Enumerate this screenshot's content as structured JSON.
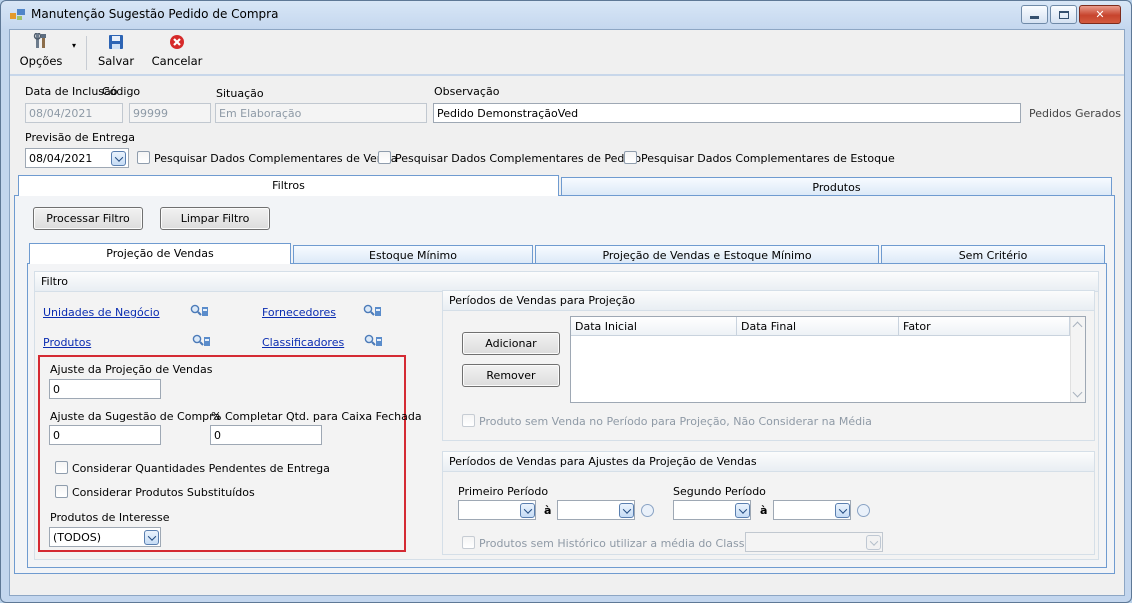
{
  "window": {
    "title": "Manutenção Sugestão Pedido de Compra",
    "controls": [
      "minimize-icon",
      "maximize-icon",
      "close-icon"
    ]
  },
  "toolbar": {
    "options_label": "Opções",
    "save_label": "Salvar",
    "cancel_label": "Cancelar",
    "icons": {
      "options": "tools-icon",
      "save": "floppy-disk-icon",
      "cancel": "cancel-x-icon"
    }
  },
  "header": {
    "data_inclusao_label": "Data de Inclusão",
    "data_inclusao_value": "08/04/2021",
    "codigo_label": "Código",
    "codigo_value": "99999",
    "situacao_label": "Situação",
    "situacao_value": "Em Elaboração",
    "observacao_label": "Observação",
    "observacao_value": "Pedido DemonstraçãoVed",
    "pedidos_gerados": "Pedidos Gerados",
    "previsao_label": "Previsão de Entrega",
    "previsao_value": "08/04/2021",
    "chk_venda": "Pesquisar Dados Complementares de Venda",
    "chk_pedido": "Pesquisar Dados Complementares de Pedido",
    "chk_estoque": "Pesquisar Dados Complementares de Estoque"
  },
  "main_tabs": {
    "filtros": "Filtros",
    "produtos": "Produtos"
  },
  "filter_buttons": {
    "processar": "Processar Filtro",
    "limpar": "Limpar Filtro"
  },
  "sub_tabs": {
    "projecao": "Projeção de Vendas",
    "estoque": "Estoque Mínimo",
    "proj_estoque": "Projeção de Vendas e Estoque Mínimo",
    "sem": "Sem Critério"
  },
  "filtro": {
    "title": "Filtro",
    "unidades": "Unidades de Negócio",
    "fornecedores": "Fornecedores",
    "produtos": "Produtos",
    "classificadores": "Classificadores",
    "ajuste_projecao_label": "Ajuste da Projeção de Vendas",
    "ajuste_projecao_value": "0",
    "ajuste_sugestao_label": "Ajuste da Sugestão de Compra",
    "ajuste_sugestao_value": "0",
    "completar_label": "% Completar Qtd. para Caixa Fechada",
    "completar_value": "0",
    "chk_pendentes": "Considerar Quantidades Pendentes de Entrega",
    "chk_substituidos": "Considerar Produtos Substituídos",
    "interesse_label": "Produtos de Interesse",
    "interesse_value": "(TODOS)",
    "colors": {
      "highlight_border": "#d42a33",
      "link": "#0b2db1"
    }
  },
  "periodos": {
    "title": "Períodos de Vendas para Projeção",
    "adicionar": "Adicionar",
    "remover": "Remover",
    "columns": [
      "Data Inicial",
      "Data Final",
      "Fator"
    ],
    "rows": [],
    "chk_sem_venda": "Produto sem Venda no Período para Projeção, Não Considerar na Média"
  },
  "ajustes": {
    "title": "Períodos de Vendas para Ajustes da Projeção de Vendas",
    "primeiro_label": "Primeiro Período",
    "segundo_label": "Segundo Período",
    "sep": "à",
    "chk_historico": "Produtos sem Histórico utilizar a média do Classificador"
  }
}
